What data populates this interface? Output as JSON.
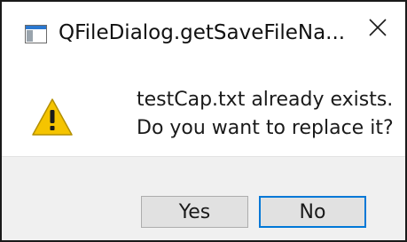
{
  "window": {
    "title": "QFileDialog.getSaveFileNa...",
    "app_icon": "window-app-icon",
    "close_icon": "close-icon"
  },
  "message": {
    "icon": "warning-icon",
    "line1": "testCap.txt already exists.",
    "line2": "Do you want to replace it?"
  },
  "buttons": {
    "yes_label": "Yes",
    "no_label": "No",
    "default_button": "No"
  },
  "colors": {
    "accent_focus": "#0078d7",
    "footer_bg": "#f0f0f0",
    "warning_yellow": "#f5c400"
  }
}
